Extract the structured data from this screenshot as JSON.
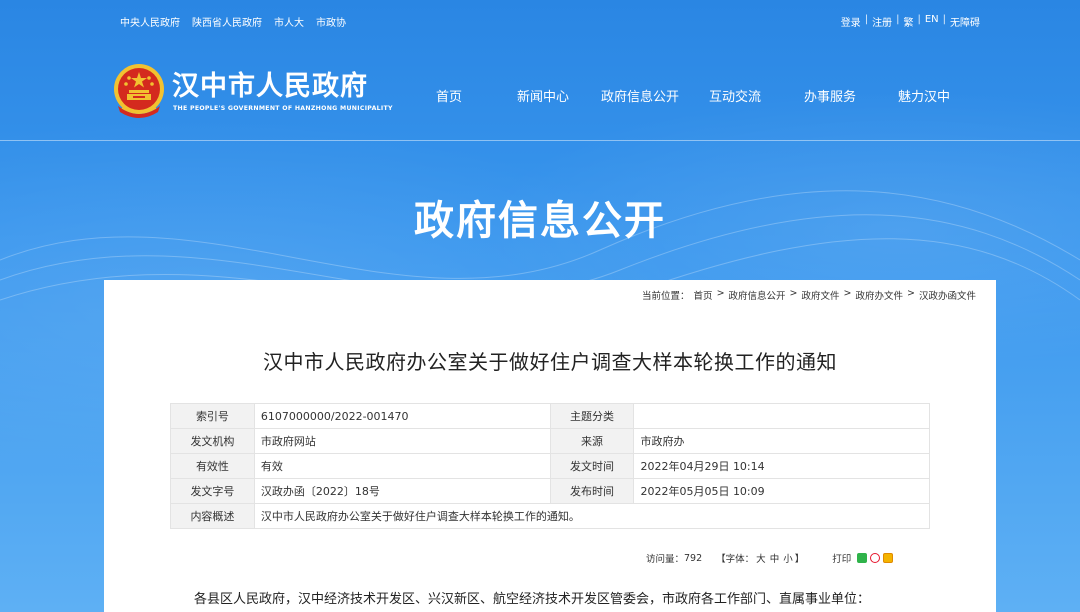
{
  "top_links": [
    "中央人民政府",
    "陕西省人民政府",
    "市人大",
    "市政协"
  ],
  "top_right": {
    "login": "登录",
    "register": "注册",
    "traditional": "繁",
    "english": "EN",
    "accessible": "无障碍",
    "sep": "|"
  },
  "site": {
    "title": "汉中市人民政府",
    "subtitle": "THE PEOPLE'S GOVERNMENT OF HANZHONG MUNICIPALITY"
  },
  "nav": [
    "首页",
    "新闻中心",
    "政府信息公开",
    "互动交流",
    "办事服务",
    "魅力汉中"
  ],
  "banner_title": "政府信息公开",
  "breadcrumb": {
    "prefix": "当前位置：",
    "items": [
      "首页",
      "政府信息公开",
      "政府文件",
      "政府办文件",
      "汉政办函文件"
    ],
    "sep": ">"
  },
  "document": {
    "title": "汉中市人民政府办公室关于做好住户调查大样本轮换工作的通知",
    "meta": {
      "index_label": "索引号",
      "index_value": "6107000000/2022-001470",
      "topic_label": "主题分类",
      "topic_value": "",
      "issuer_label": "发文机构",
      "issuer_value": "市政府网站",
      "source_label": "来源",
      "source_value": "市政府办",
      "validity_label": "有效性",
      "validity_value": "有效",
      "issue_time_label": "发文时间",
      "issue_time_value": "2022年04月29日 10:14",
      "doc_no_label": "发文字号",
      "doc_no_value": "汉政办函〔2022〕18号",
      "publish_time_label": "发布时间",
      "publish_time_value": "2022年05月05日 10:09",
      "summary_label": "内容概述",
      "summary_value": "汉中市人民政府办公室关于做好住户调查大样本轮换工作的通知。"
    },
    "tools": {
      "visits_label": "访问量：",
      "visits_value": "792",
      "font_open": "【字体：",
      "font_large": "大",
      "font_medium": "中",
      "font_small": "小",
      "font_close": "】",
      "print": "打印"
    },
    "intro": "各县区人民政府，汉中经济技术开发区、兴汉新区、航空经济技术开发区管委会，市政府各工作部门、直属事业单位："
  },
  "colors": {
    "header_blue": "#2a86e3",
    "emblem_red": "#d42a1e",
    "emblem_gold": "#f2c230"
  }
}
